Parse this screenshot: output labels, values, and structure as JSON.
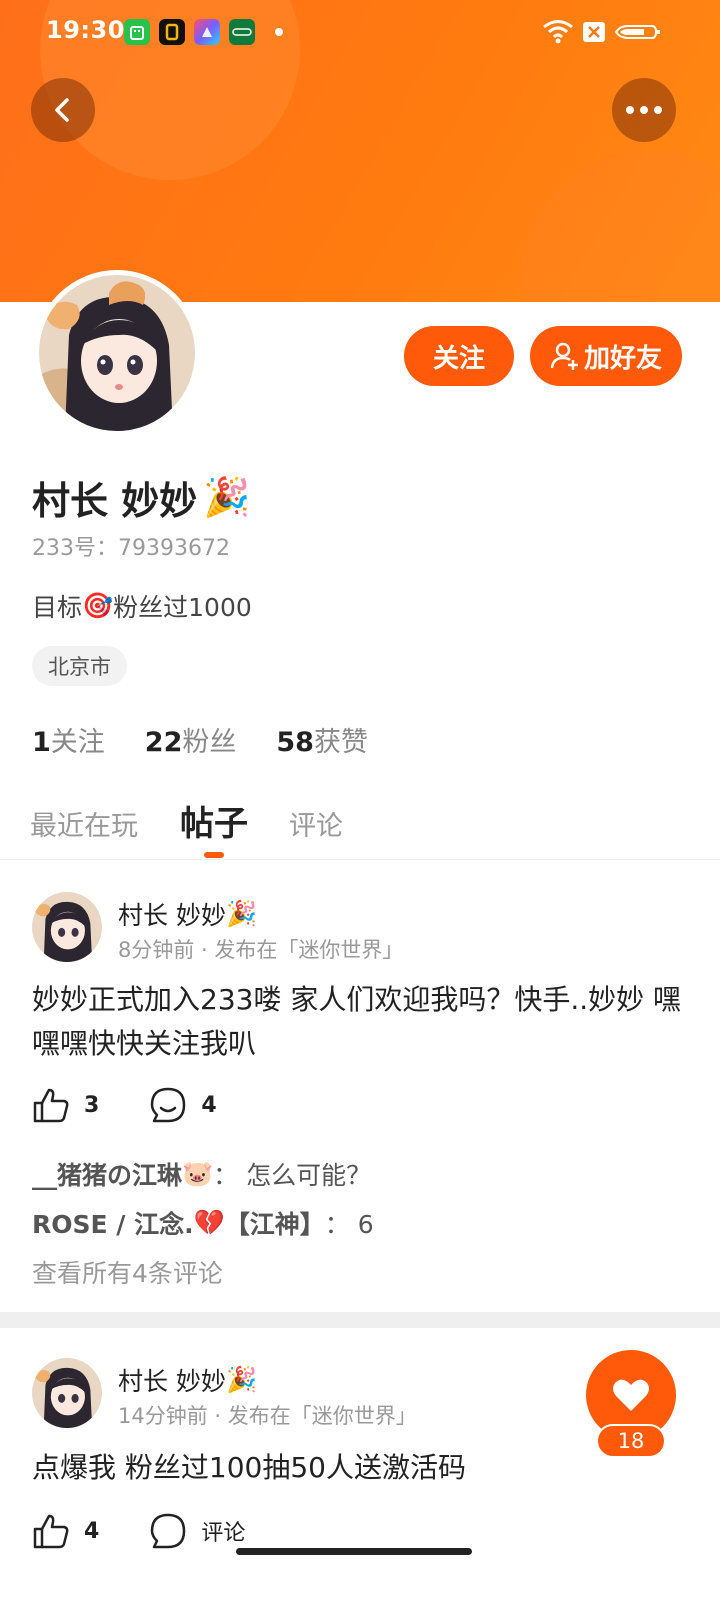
{
  "status_bar": {
    "time": "19:30",
    "app_icons": [
      {
        "name": "app-icon-green",
        "color": "#27c24c"
      },
      {
        "name": "app-icon-black",
        "color": "#111111"
      },
      {
        "name": "app-icon-multicolor",
        "color": "#7a5cff"
      },
      {
        "name": "app-icon-dark-green",
        "color": "#0f7a3a"
      }
    ],
    "icons": [
      "wifi-icon",
      "sim-blocked-icon",
      "battery-icon"
    ]
  },
  "header": {
    "back_icon": "chevron-left-icon",
    "more_icon": "more-dots-icon",
    "banner_color": "#ff7a0f"
  },
  "profile": {
    "name": "村长 妙妙",
    "name_emoji": "🎉",
    "id_text": "233号：79393672",
    "bio_prefix": "目标",
    "bio_emoji": "🎯",
    "bio_suffix": "粉丝过1000",
    "location": "北京市",
    "follow_label": "关注",
    "add_friend_label": "加好友",
    "accent_color": "#ff5a0a"
  },
  "stats": [
    {
      "value": "1",
      "label": "关注"
    },
    {
      "value": "22",
      "label": "粉丝"
    },
    {
      "value": "58",
      "label": "获赞"
    }
  ],
  "tabs": [
    {
      "label": "最近在玩",
      "active": false
    },
    {
      "label": "帖子",
      "active": true
    },
    {
      "label": "评论",
      "active": false
    }
  ],
  "posts": [
    {
      "author": "村长 妙妙",
      "author_emoji": "🎉",
      "meta": "8分钟前 · 发布在「迷你世界」",
      "text": "妙妙正式加入233喽 家人们欢迎我吗？快手..妙妙 嘿嘿嘿快快关注我叭",
      "likes": "3",
      "comments": "4",
      "comment_list": [
        {
          "user": "__猪猪の江琳",
          "emoji": "🐷",
          "text": "：  怎么可能？"
        },
        {
          "user": "ROSE / 江念.",
          "emoji": "💔",
          "user_suffix": "【江神】",
          "text": "：  6"
        }
      ],
      "see_all": "查看所有4条评论"
    },
    {
      "author": "村长 妙妙",
      "author_emoji": "🎉",
      "meta": "14分钟前 · 发布在「迷你世界」",
      "text": "点爆我 粉丝过100抽50人送激活码",
      "likes": "4",
      "comments_label": "评论"
    }
  ],
  "floating_like": {
    "icon": "heart-icon",
    "count": "18"
  }
}
